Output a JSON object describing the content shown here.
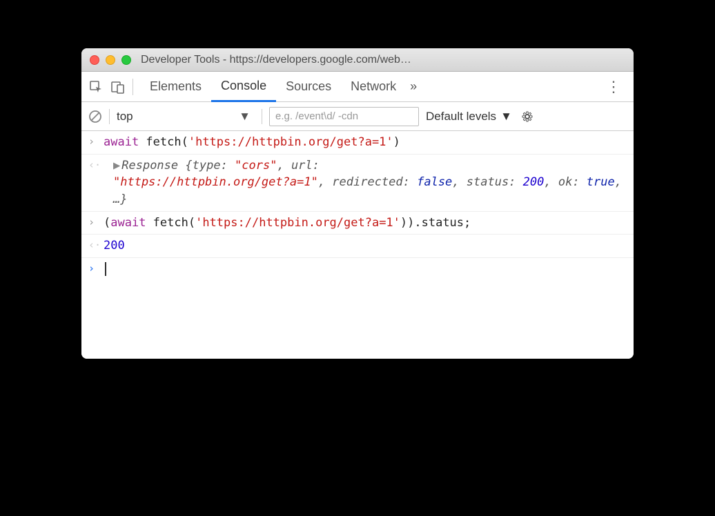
{
  "window": {
    "title": "Developer Tools - https://developers.google.com/web…"
  },
  "tabs": {
    "elements": "Elements",
    "console": "Console",
    "sources": "Sources",
    "network": "Network",
    "more": "»"
  },
  "toolbar": {
    "scope": "top",
    "filter_placeholder": "e.g. /event\\d/ -cdn",
    "levels": "Default levels"
  },
  "console": {
    "line1": {
      "await": "await",
      "fn": " fetch(",
      "url": "'https://httpbin.org/get?a=1'",
      "close": ")"
    },
    "resp": {
      "label": "Response ",
      "open": "{",
      "type_k": "type: ",
      "type_v": "\"cors\"",
      "url_k": ", url: ",
      "url_v": "\"https://httpbin.org/get?a=1\"",
      "redir_k": ", redirected: ",
      "redir_v": "false",
      "status_k": ", status: ",
      "status_v": "200",
      "ok_k": ", ok: ",
      "ok_v": "true",
      "rest": ", …}"
    },
    "line2": {
      "open": "(",
      "await": "await",
      "fn": " fetch(",
      "url": "'https://httpbin.org/get?a=1'",
      "close": ")).status;"
    },
    "out2": "200"
  }
}
